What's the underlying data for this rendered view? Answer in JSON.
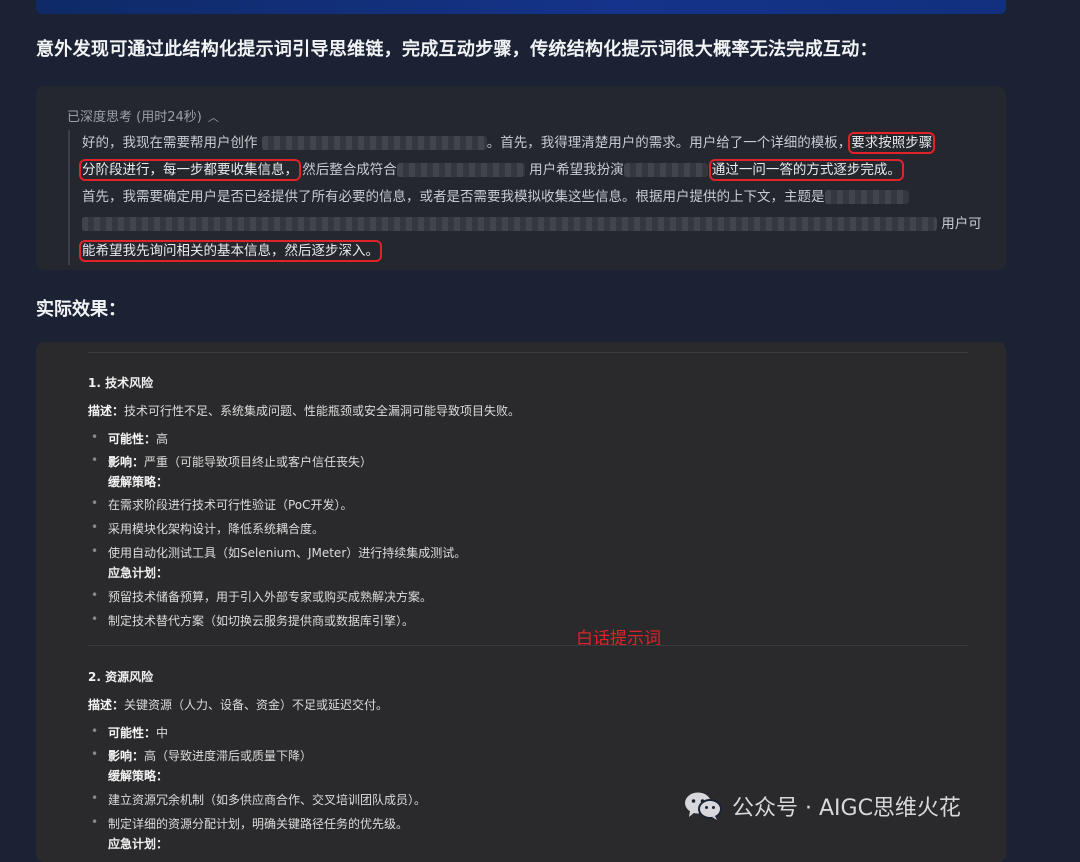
{
  "heading": "意外发现可通过此结构化提示词引导思维链，完成互动步骤，传统结构化提示词很大概率无法完成互动：",
  "thinking": {
    "header": "已深度思考 (用时24秒)",
    "line1_a": "好的，我现在需要帮用户创作",
    "line1_b": "。首先，我得理清楚用户的需求。用户给了一个详细的模板，",
    "line1_hl": "要求按照步骤",
    "line2_hl": "分阶段进行，每一步都要收集信息，",
    "line2_a": "然后整合成符合",
    "line2_b": "用户希望我扮演",
    "line2_hl2": "通过一问一答的方式逐步完成。",
    "line3": "首先，我需要确定用户是否已经提供了所有必要的信息，或者是否需要我模拟收集这些信息。根据用户提供的上下文，主题是",
    "line4_tail": "用户可",
    "line5_hl": "能希望我先询问相关的基本信息，然后逐步深入。"
  },
  "effect_label": "实际效果：",
  "effect": {
    "section1": {
      "title": "1. 技术风险",
      "desc_label": "描述：",
      "desc": "技术可行性不足、系统集成问题、性能瓶颈或安全漏洞可能导致项目失败。",
      "possibility_label": "可能性：",
      "possibility": "高",
      "impact_label": "影响：",
      "impact": "严重（可能导致项目终止或客户信任丧失）",
      "mitigation_label": "缓解策略：",
      "mitigation": [
        "在需求阶段进行技术可行性验证（PoC开发）。",
        "采用模块化架构设计，降低系统耦合度。",
        "使用自动化测试工具（如Selenium、JMeter）进行持续集成测试。"
      ],
      "contingency_label": "应急计划：",
      "contingency": [
        "预留技术储备预算，用于引入外部专家或购买成熟解决方案。",
        "制定技术替代方案（如切换云服务提供商或数据库引擎）。"
      ]
    },
    "note": "白话提示词",
    "section2": {
      "title": "2. 资源风险",
      "desc_label": "描述：",
      "desc": "关键资源（人力、设备、资金）不足或延迟交付。",
      "possibility_label": "可能性：",
      "possibility": "中",
      "impact_label": "影响：",
      "impact": "高（导致进度滞后或质量下降）",
      "mitigation_label": "缓解策略：",
      "mitigation": [
        "建立资源冗余机制（如多供应商合作、交叉培训团队成员）。",
        "制定详细的资源分配计划，明确关键路径任务的优先级。"
      ],
      "contingency_label": "应急计划："
    }
  },
  "watermark": "公众号 · AIGC思维火花",
  "colors": {
    "highlight": "#e0222a",
    "page_bg": "#1a2233",
    "panel_bg": "#24272d"
  }
}
